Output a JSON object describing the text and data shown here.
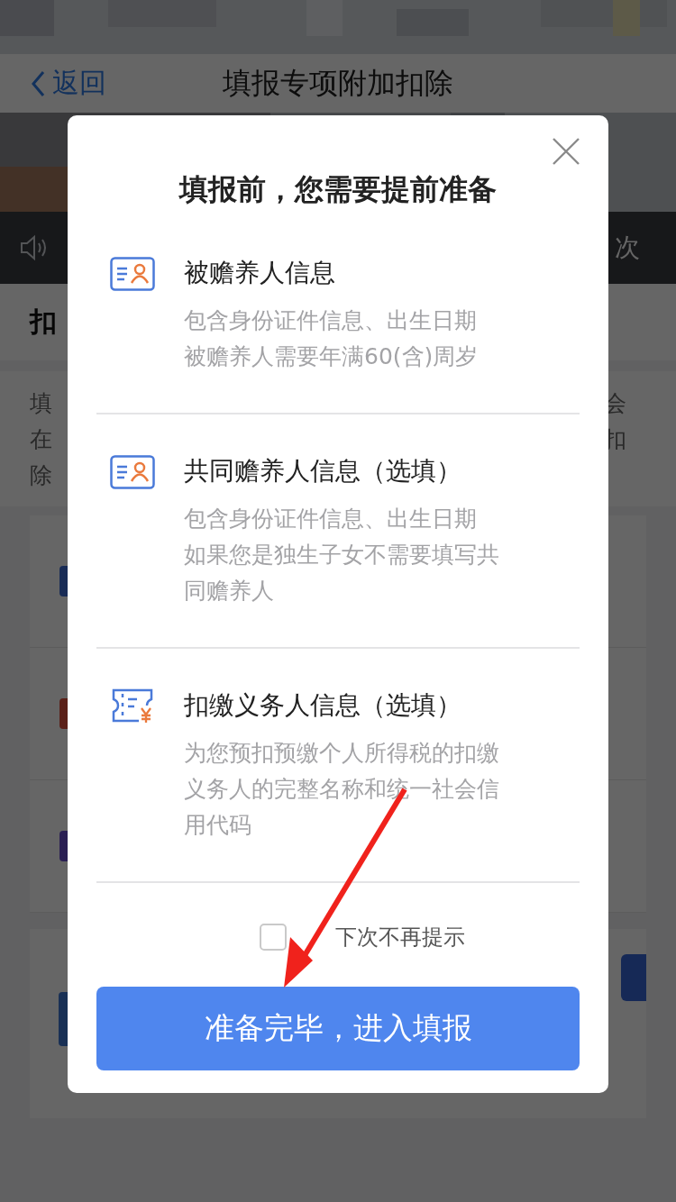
{
  "header": {
    "back": "返回",
    "title": "填报专项附加扣除"
  },
  "notice_bar": {
    "text": "次"
  },
  "section": {
    "heading": "扣"
  },
  "intro": {
    "left_lines": [
      "填",
      "在",
      "除"
    ],
    "right_lines": [
      "会",
      "扣"
    ]
  },
  "dialog": {
    "title": "填报前，您需要提前准备",
    "items": [
      {
        "kind": "person",
        "title": "被赡养人信息",
        "lines": [
          "包含身份证件信息、出生日期",
          "被赡养人需要年满60(含)周岁"
        ]
      },
      {
        "kind": "person",
        "title": "共同赡养人信息（选填）",
        "lines": [
          "包含身份证件信息、出生日期",
          "如果您是独生子女不需要填写共",
          "同赡养人"
        ]
      },
      {
        "kind": "ticket",
        "title": "扣缴义务人信息（选填）",
        "lines": [
          "为您预扣预缴个人所得税的扣缴",
          "义务人的完整名称和统一社会信",
          "用代码"
        ]
      }
    ],
    "dont_show_again": {
      "label": "下次不再提示",
      "checked": false
    },
    "confirm_button": "准备完毕，进入填报"
  }
}
